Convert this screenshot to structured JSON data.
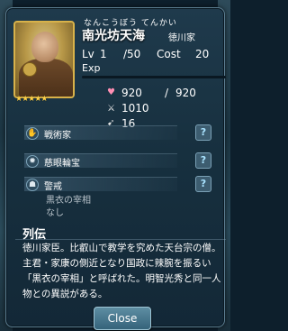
{
  "officer": {
    "ruby": "なんこうぼう てんかい",
    "name": "南光坊天海",
    "clan": "徳川家",
    "level_label": "Lv",
    "level": "1",
    "level_max": "/50",
    "cost_label": "Cost",
    "cost": "20",
    "exp_label": "Exp",
    "exp_progress": 0,
    "rarity_stars": "★★★★★"
  },
  "stats": {
    "hp": "920",
    "hp_sep": "/",
    "hp_max": "920",
    "attack": "1010",
    "speed": "16"
  },
  "skills": [
    {
      "label": "戦術家",
      "icon": "hand-icon",
      "help": "?"
    },
    {
      "label": "慈眼輪宝",
      "icon": "gear-icon",
      "help": "?"
    },
    {
      "label": "警戒",
      "icon": "person-icon",
      "help": "?",
      "sub": [
        "黒衣の宰相",
        "なし"
      ]
    }
  ],
  "bio": {
    "title": "列伝",
    "text": "徳川家臣。比叡山で教学を究めた天台宗の僧。主君・家康の側近となり国政に辣腕を振るい「黒衣の宰相」と呼ばれた。明智光秀と同一人物との異説がある。"
  },
  "close_label": "Close"
}
